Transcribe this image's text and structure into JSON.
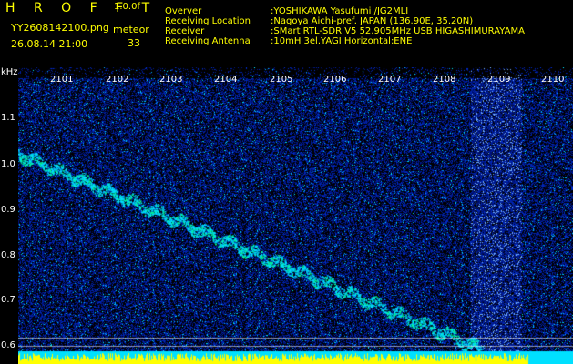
{
  "header": {
    "app_title": "H R O F F T",
    "version": "1.0.0f",
    "filename": "YY2608142100.png",
    "datetime": "26.08.14 21:00",
    "meteor_label": "meteor",
    "meteor_count": "33",
    "info": [
      {
        "label": "Overver",
        "value": ":YOSHIKAWA Yasufumi /JG2MLI"
      },
      {
        "label": "Receiving Location",
        "value": ":Nagoya Aichi-pref. JAPAN (136.90E, 35.20N)"
      },
      {
        "label": "Receiver",
        "value": ":SMart RTL-SDR V5 52.905MHz USB HIGASHIMURAYAMA"
      },
      {
        "label": "Receiving Antenna",
        "value": ":10mH 3el.YAGI Horizontal:ENE"
      }
    ]
  },
  "axes": {
    "y_unit": "kHz",
    "y_ticks": [
      "1.1",
      "1.0",
      "0.9",
      "0.8",
      "0.7",
      "0.6"
    ],
    "x_ticks": [
      "2101",
      "2102",
      "2103",
      "2104",
      "2105",
      "2106",
      "2107",
      "2108",
      "2109",
      "2110"
    ]
  },
  "colors": {
    "background": "#000000",
    "noise": "#0a1f8a",
    "signal": "#00e0ff",
    "echo": "#00ff90",
    "bottom_band": "#ffff00",
    "text_yellow": "#ffff00",
    "text_white": "#ffffff"
  }
}
